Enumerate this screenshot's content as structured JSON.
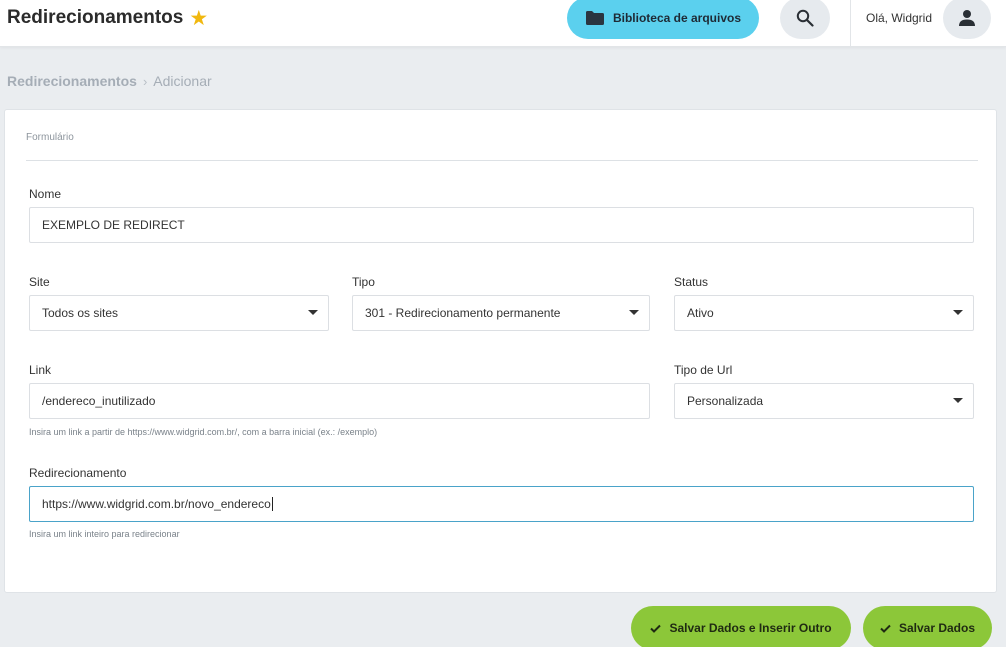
{
  "header": {
    "title": "Redirecionamentos",
    "star_icon": "star-icon",
    "library_button_label": "Biblioteca de arquivos",
    "library_icon": "folder-icon",
    "search_icon": "search-icon",
    "greeting": "Olá, Widgrid",
    "user_icon": "user-icon",
    "colors": {
      "library_button": "#5bd0ee",
      "star": "#f1b80f"
    }
  },
  "breadcrumb": {
    "root": "Redirecionamentos",
    "separator": "›",
    "current": "Adicionar"
  },
  "form": {
    "section_title": "Formulário",
    "nome": {
      "label": "Nome",
      "value": "EXEMPLO DE REDIRECT"
    },
    "site": {
      "label": "Site",
      "value": "Todos os sites"
    },
    "tipo": {
      "label": "Tipo",
      "value": "301 - Redirecionamento permanente"
    },
    "status": {
      "label": "Status",
      "value": "Ativo"
    },
    "link": {
      "label": "Link",
      "value": "/endereco_inutilizado",
      "help": "Insira um link a partir de https://www.widgrid.com.br/, com a barra inicial (ex.: /exemplo)"
    },
    "tipo_url": {
      "label": "Tipo de Url",
      "value": "Personalizada"
    },
    "redirecionamento": {
      "label": "Redirecionamento",
      "value": "https://www.widgrid.com.br/novo_endereco",
      "help": "Insira um link inteiro para redirecionar"
    }
  },
  "actions": {
    "save_and_new_label": "Salvar Dados e Inserir Outro",
    "save_label": "Salvar Dados",
    "check_icon": "check-icon",
    "colors": {
      "button": "#8cc739"
    }
  }
}
